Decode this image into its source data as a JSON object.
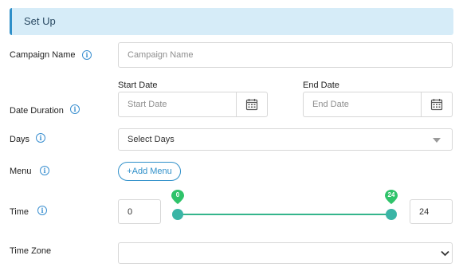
{
  "section": {
    "title": "Set Up"
  },
  "campaign": {
    "label": "Campaign Name",
    "placeholder": "Campaign Name"
  },
  "date_duration": {
    "label": "Date Duration",
    "start_label": "Start Date",
    "start_placeholder": "Start Date",
    "end_label": "End Date",
    "end_placeholder": "End Date"
  },
  "days": {
    "label": "Days",
    "placeholder": "Select Days"
  },
  "menu": {
    "label": "Menu",
    "add_button": "+Add Menu"
  },
  "time": {
    "label": "Time",
    "min_value": "0",
    "max_value": "24",
    "slider_min": 0,
    "slider_max": 24
  },
  "time_zone": {
    "label": "Time Zone",
    "value": ""
  },
  "colors": {
    "accent": "#2e8fc9",
    "slider": "#3ab5a6",
    "bubble": "#2fc36a",
    "header_bg": "#d6ecf8"
  },
  "icons": {
    "info": "info-icon",
    "calendar": "calendar-icon",
    "caret": "caret-down-icon",
    "chevron": "chevron-down-icon"
  }
}
